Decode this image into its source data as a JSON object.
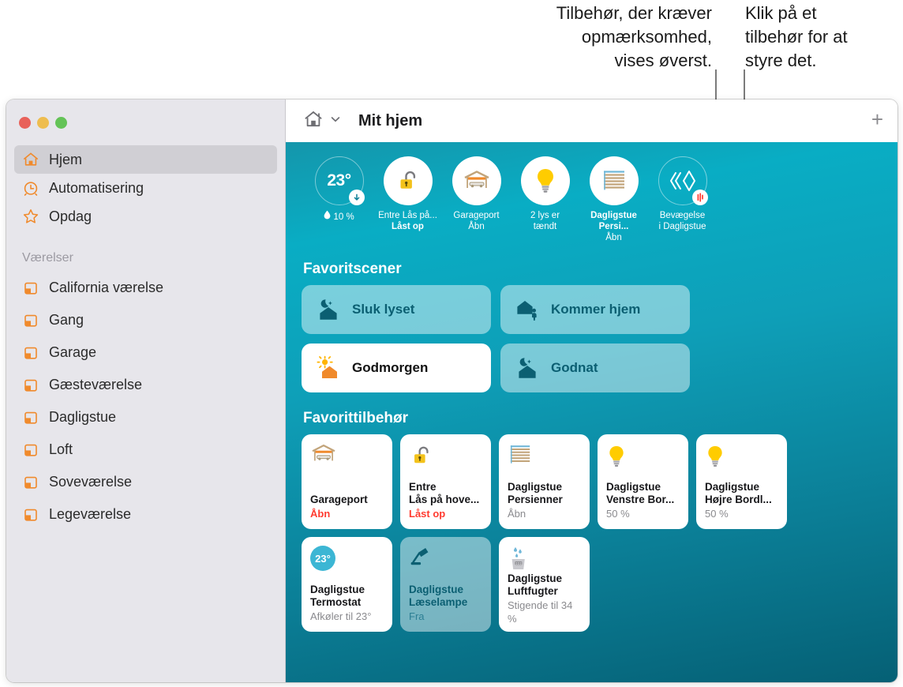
{
  "callouts": [
    {
      "id": "attention",
      "text": "Tilbehør, der kræver\nopmærksomhed,\nvises øverst."
    },
    {
      "id": "click",
      "text": "Klik på et\ntilbehør for at\nstyre det."
    }
  ],
  "window": {
    "traffic_lights": [
      "close",
      "minimize",
      "zoom"
    ]
  },
  "sidebar": {
    "top_items": [
      {
        "label": "Hjem",
        "icon": "house-icon",
        "selected": true
      },
      {
        "label": "Automatisering",
        "icon": "clock-icon",
        "selected": false
      },
      {
        "label": "Opdag",
        "icon": "star-icon",
        "selected": false
      }
    ],
    "section_header": "Værelser",
    "rooms": [
      {
        "label": "California værelse",
        "icon": "room-icon"
      },
      {
        "label": "Gang",
        "icon": "room-icon"
      },
      {
        "label": "Garage",
        "icon": "room-icon"
      },
      {
        "label": "Gæsteværelse",
        "icon": "room-icon"
      },
      {
        "label": "Dagligstue",
        "icon": "room-icon"
      },
      {
        "label": "Loft",
        "icon": "room-icon"
      },
      {
        "label": "Soveværelse",
        "icon": "room-icon"
      },
      {
        "label": "Legeværelse",
        "icon": "room-icon"
      }
    ]
  },
  "toolbar": {
    "home_icon": "house-icon",
    "chevron_icon": "chevron-down-icon",
    "title": "Mit hjem",
    "add_label": "+"
  },
  "status_strip": [
    {
      "icon": "thermometer-circle-icon",
      "style": "outline",
      "value": "23°",
      "badge": "arrow-down-icon",
      "sub_icon": "humidity-drop-icon",
      "line1": "10 %",
      "line2": "",
      "bold": false
    },
    {
      "icon": "unlocked-padlock-icon",
      "style": "filled",
      "line1": "Entre Lås på...",
      "line2": "Låst op",
      "bold": true
    },
    {
      "icon": "garage-door-icon",
      "style": "filled",
      "line1": "Garageport",
      "line2": "Åbn",
      "bold": false
    },
    {
      "icon": "lightbulb-icon",
      "style": "filled",
      "line1": "2 lys er",
      "line2": "tændt",
      "bold": false
    },
    {
      "icon": "blinds-icon",
      "style": "filled",
      "line1": "Dagligstue Persi...",
      "line2": "Åbn",
      "bold": false
    },
    {
      "icon": "motion-sensor-icon",
      "style": "outline",
      "badge": "sound-wave-icon",
      "line1": "Bevægelse",
      "line2": "i Dagligstue",
      "bold": false
    }
  ],
  "scenes": {
    "title": "Favoritscener",
    "items": [
      {
        "label": "Sluk lyset",
        "icon": "moon-house-icon",
        "active": false
      },
      {
        "label": "Kommer hjem",
        "icon": "house-person-icon",
        "active": false
      },
      {
        "label": "Godmorgen",
        "icon": "sun-house-icon",
        "active": true
      },
      {
        "label": "Godnat",
        "icon": "moon-house-icon",
        "active": false
      }
    ]
  },
  "accessories": {
    "title": "Favorittilbehør",
    "items": [
      {
        "icon": "garage-door-icon",
        "name": "Garageport",
        "state": "Åbn",
        "alert": true,
        "dim": false
      },
      {
        "icon": "unlocked-padlock-icon",
        "name": "Entre\nLås på hove...",
        "state": "Låst op",
        "alert": true,
        "dim": false
      },
      {
        "icon": "blinds-icon",
        "name": "Dagligstue\nPersienner",
        "state": "Åbn",
        "alert": false,
        "dim": false
      },
      {
        "icon": "lightbulb-icon",
        "name": "Dagligstue\nVenstre Bor...",
        "state": "50 %",
        "alert": false,
        "dim": false
      },
      {
        "icon": "lightbulb-icon",
        "name": "Dagligstue\nHøjre Bordl...",
        "state": "50 %",
        "alert": false,
        "dim": false
      },
      {
        "icon": "thermostat-bubble-icon",
        "icon_text": "23°",
        "name": "Dagligstue\nTermostat",
        "state": "Afkøler til 23°",
        "alert": false,
        "dim": false
      },
      {
        "icon": "desk-lamp-icon",
        "name": "Dagligstue\nLæselampe",
        "state": "Fra",
        "alert": false,
        "dim": true
      },
      {
        "icon": "humidifier-icon",
        "name": "Dagligstue\nLuftfugter",
        "state": "Stigende til 34 %",
        "alert": false,
        "dim": false
      }
    ]
  },
  "colors": {
    "accent_orange": "#f08a2c",
    "alert_red": "#ff3b30",
    "teal_top": "#09adc4",
    "teal_bottom": "#056075",
    "scene_blue": "#0b5f72",
    "bulb_yellow": "#ffcc00"
  }
}
